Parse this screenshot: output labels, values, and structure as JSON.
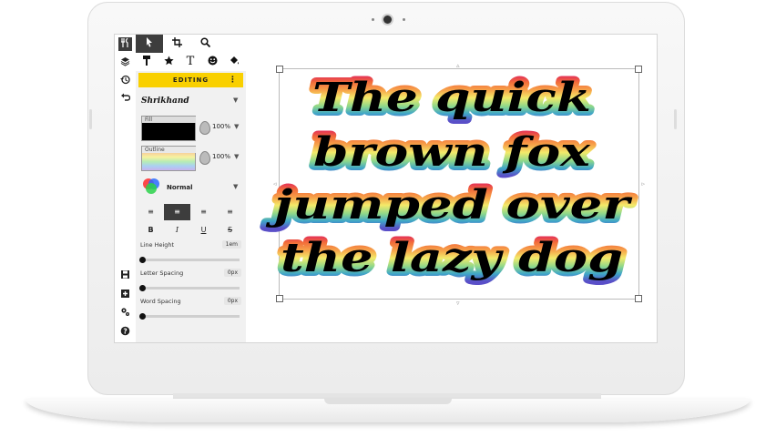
{
  "editor": {
    "editing_label": "EDITING",
    "font_name": "Shrikhand",
    "fill_label": "Fill",
    "fill_opacity": "100%",
    "outline_label": "Outline",
    "outline_opacity": "100%",
    "blend_mode": "Normal",
    "format_bold": "B",
    "format_italic": "I",
    "format_underline": "U",
    "format_strike": "S",
    "line_height_label": "Line Height",
    "line_height_value": "1em",
    "letter_spacing_label": "Letter Spacing",
    "letter_spacing_value": "0px",
    "word_spacing_label": "Word Spacing",
    "word_spacing_value": "0px",
    "fill_color": "#000000"
  },
  "canvas": {
    "lines": [
      "The quick",
      "brown fox",
      "jumped over",
      "the lazy dog"
    ]
  },
  "icons": {
    "strip": [
      "layers-icon",
      "history-icon",
      "undo-icon",
      "save-icon",
      "add-image-icon",
      "settings-icon",
      "help-icon"
    ],
    "tools": [
      "utensils-icon",
      "pointer-icon",
      "crop-icon",
      "zoom-icon",
      "paint-icon",
      "star-icon",
      "text-icon",
      "emoji-icon",
      "fill-bucket-icon"
    ]
  }
}
